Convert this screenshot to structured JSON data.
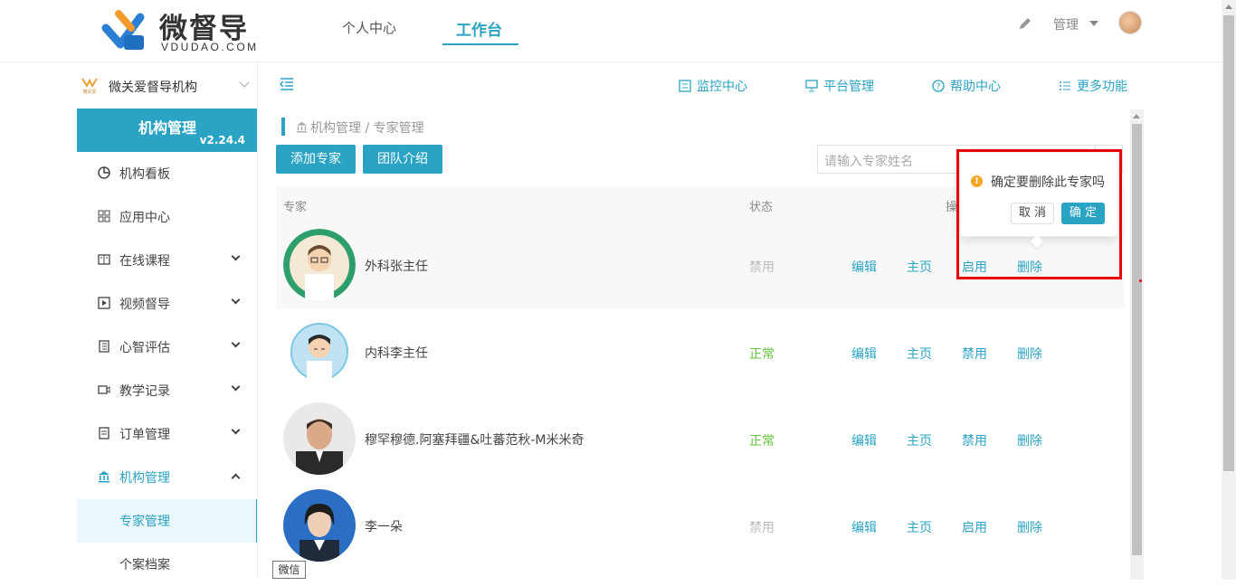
{
  "brand": {
    "name": "微督导",
    "sub": "VDUDAO.COM",
    "color": "#2aa3c4"
  },
  "top_nav": {
    "tabs": [
      "个人中心",
      "工作台"
    ],
    "active": "工作台",
    "user_menu": "管理"
  },
  "org": {
    "logo_text": "微关爱",
    "name": "微关爱督导机构"
  },
  "sidebar": {
    "header": "机构管理",
    "version": "v2.24.4",
    "items": [
      {
        "label": "机构看板",
        "icon": "dashboard-icon"
      },
      {
        "label": "应用中心",
        "icon": "grid-icon"
      },
      {
        "label": "在线课程",
        "icon": "book-icon"
      },
      {
        "label": "视频督导",
        "icon": "video-play-icon"
      },
      {
        "label": "心智评估",
        "icon": "clipboard-icon"
      },
      {
        "label": "教学记录",
        "icon": "camera-icon"
      },
      {
        "label": "订单管理",
        "icon": "receipt-icon"
      },
      {
        "label": "机构管理",
        "icon": "bank-icon"
      }
    ],
    "sub_items": [
      "专家管理",
      "个案档案"
    ]
  },
  "toolbar": {
    "items": [
      "监控中心",
      "平台管理",
      "帮助中心",
      "更多功能"
    ]
  },
  "breadcrumb": "机构管理 / 专家管理",
  "actions": {
    "add": "添加专家",
    "team": "团队介绍"
  },
  "search": {
    "placeholder": "请输入专家姓名"
  },
  "table": {
    "headers": {
      "expert": "专家",
      "status": "状态",
      "ops": "操"
    },
    "rows": [
      {
        "name": "外科张主任",
        "status": "禁用",
        "ops": [
          "编辑",
          "主页",
          "启用",
          "删除"
        ]
      },
      {
        "name": "内科李主任",
        "status": "正常",
        "ops": [
          "编辑",
          "主页",
          "禁用",
          "删除"
        ]
      },
      {
        "name": "穆罕穆德.阿塞拜疆&吐蕃范秋-M米米奇",
        "status": "正常",
        "ops": [
          "编辑",
          "主页",
          "禁用",
          "删除"
        ]
      },
      {
        "name": "李一朵",
        "status": "禁用",
        "ops": [
          "编辑",
          "主页",
          "启用",
          "删除"
        ]
      }
    ]
  },
  "popconfirm": {
    "message": "确定要删除此专家吗",
    "cancel": "取 消",
    "confirm": "确 定"
  },
  "tooltip": "微信"
}
